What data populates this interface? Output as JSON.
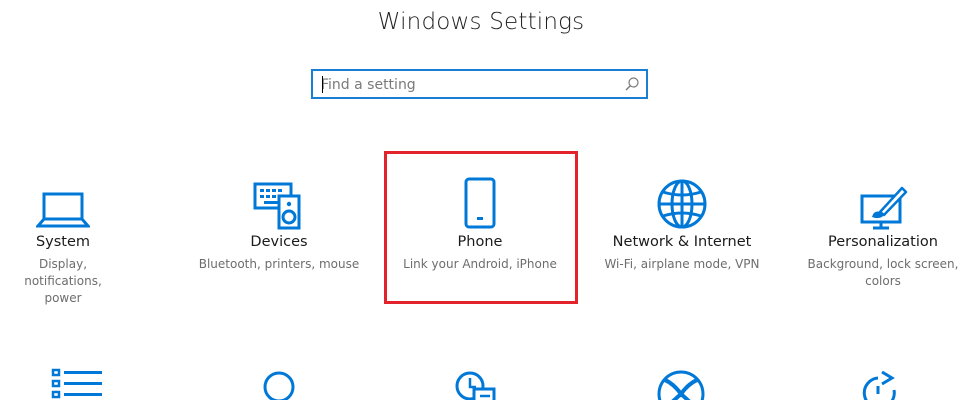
{
  "window": {
    "title": "Windows Settings"
  },
  "search": {
    "placeholder": "Find a setting",
    "value": "",
    "icon": "search-icon"
  },
  "colors": {
    "accent": "#0078d7",
    "highlight_border": "#e3232c",
    "title_text": "#1b1b1b",
    "description_text": "#6d6d6d"
  },
  "tiles": [
    {
      "id": "system",
      "icon": "laptop-icon",
      "title": "System",
      "description": "Display, notifications, power"
    },
    {
      "id": "devices",
      "icon": "keyboard-speaker-icon",
      "title": "Devices",
      "description": "Bluetooth, printers, mouse"
    },
    {
      "id": "phone",
      "icon": "phone-icon",
      "title": "Phone",
      "description": "Link your Android, iPhone",
      "highlighted": true
    },
    {
      "id": "network",
      "icon": "globe-icon",
      "title": "Network & Internet",
      "description": "Wi-Fi, airplane mode, VPN"
    },
    {
      "id": "personalization",
      "icon": "paint-brush-icon",
      "title": "Personalization",
      "description": "Background, lock screen, colors"
    }
  ],
  "second_row_icons": [
    "apps-list-icon",
    "person-icon",
    "time-language-icon",
    "xbox-icon",
    "ease-of-access-icon"
  ]
}
